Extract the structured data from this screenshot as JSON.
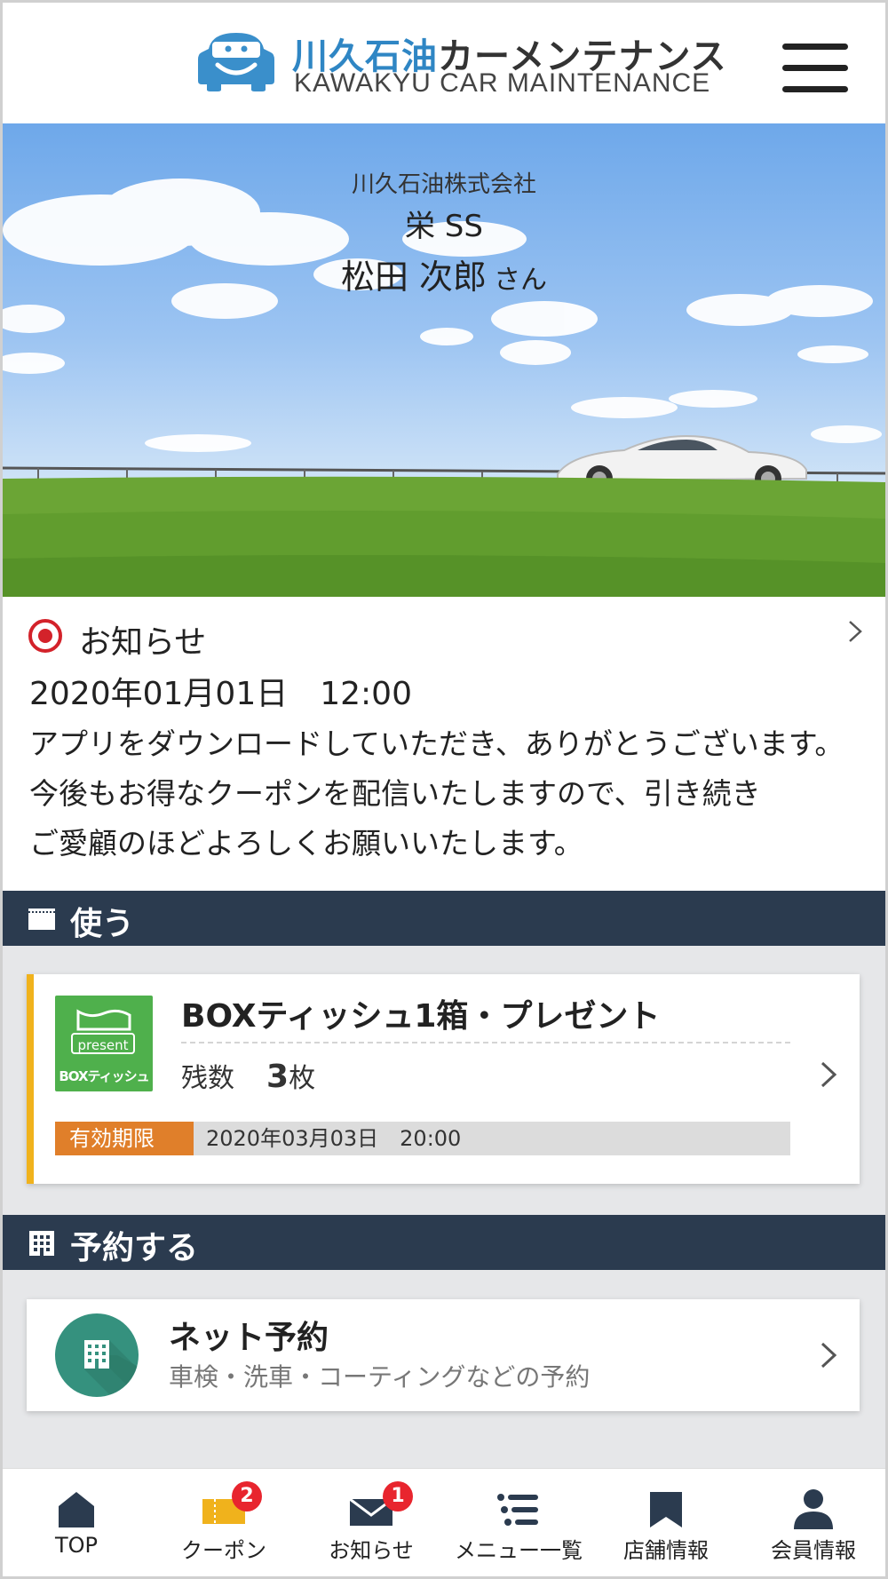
{
  "header": {
    "logo_jp_accent": "川久石油",
    "logo_jp_main": "カーメンテナンス",
    "logo_en": "KAWAKYU CAR MAINTENANCE",
    "brand_color": "#2f86c4"
  },
  "hero": {
    "company": "川久石油株式会社",
    "store": "栄 SS",
    "member_name": "松田 次郎",
    "member_suffix": "さん"
  },
  "notice": {
    "title": "お知らせ",
    "datetime": "2020年01月01日　12:00",
    "lines": [
      "アプリをダウンロードしていただき、ありがとうございます。",
      "今後もお得なクーポンを配信いたしますので、引き続き",
      "ご愛顧のほどよろしくお願いいたします。"
    ]
  },
  "use_section": {
    "title": "使う"
  },
  "coupon": {
    "thumb_present": "present",
    "thumb_label": "BOXティッシュ",
    "title": "BOXティッシュ1箱・プレゼント",
    "remaining_label": "残数",
    "remaining_count": "3",
    "remaining_unit": "枚",
    "expiry_label": "有効期限",
    "expiry_date": "2020年03月03日　20:00",
    "accent_color": "#f0b21c",
    "expiry_color": "#e07f2a"
  },
  "reserve_section": {
    "title": "予約する"
  },
  "reserve": {
    "title": "ネット予約",
    "subtitle": "車検・洗車・コーティングなどの予約",
    "icon_color": "#35917e"
  },
  "bottom_nav": {
    "items": [
      {
        "label": "TOP",
        "icon": "home-icon"
      },
      {
        "label": "クーポン",
        "icon": "ticket-icon",
        "badge": "2"
      },
      {
        "label": "お知らせ",
        "icon": "mail-icon",
        "badge": "1"
      },
      {
        "label": "メニュー一覧",
        "icon": "list-icon"
      },
      {
        "label": "店舗情報",
        "icon": "store-icon"
      },
      {
        "label": "会員情報",
        "icon": "user-icon"
      }
    ]
  }
}
